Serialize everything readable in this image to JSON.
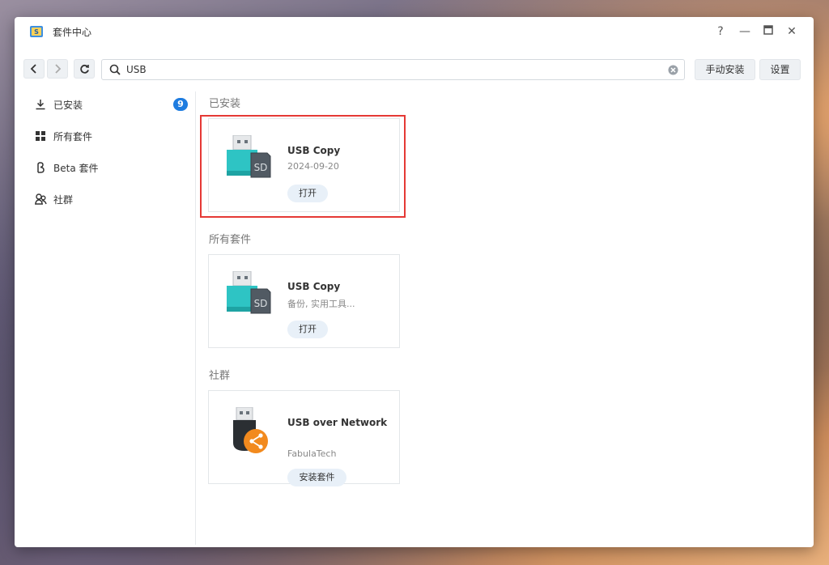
{
  "window": {
    "title": "套件中心"
  },
  "controls": {
    "help": "?",
    "minimize": "—",
    "maximize": "□",
    "close": "✕"
  },
  "toolbar": {
    "search_value": "USB",
    "manual_install_label": "手动安装",
    "settings_label": "设置"
  },
  "sidebar": {
    "items": [
      {
        "label": "已安装",
        "icon": "download-icon",
        "badge": "9"
      },
      {
        "label": "所有套件",
        "icon": "grid-icon"
      },
      {
        "label": "Beta 套件",
        "icon": "beta-icon"
      },
      {
        "label": "社群",
        "icon": "community-icon"
      }
    ]
  },
  "sections": {
    "installed": {
      "title": "已安装",
      "card": {
        "name": "USB Copy",
        "subtitle": "2024-09-20",
        "button": "打开",
        "icon": "usb-copy-icon"
      }
    },
    "all": {
      "title": "所有套件",
      "card": {
        "name": "USB Copy",
        "subtitle": "备份, 实用工具...",
        "button": "打开",
        "icon": "usb-copy-icon"
      }
    },
    "community": {
      "title": "社群",
      "card": {
        "name": "USB over Network",
        "subtitle": "FabulaTech",
        "button": "安装套件",
        "icon": "usb-network-icon"
      }
    }
  },
  "colors": {
    "accent": "#1e7ce0",
    "highlight": "#e53935",
    "teal": "#2ec4c4"
  }
}
